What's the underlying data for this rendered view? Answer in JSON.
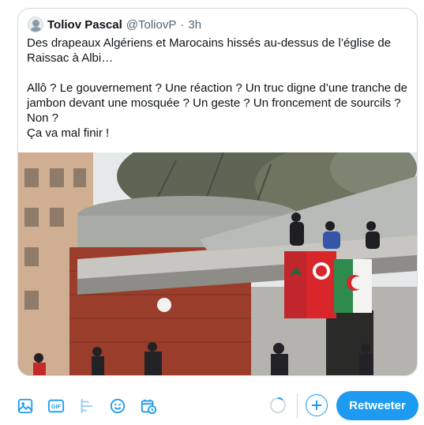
{
  "tweet": {
    "author_name": "Toliov Pascal",
    "author_handle": "@ToliovP",
    "separator": "·",
    "time": "3h",
    "lines": [
      "Des drapeaux Algériens et Marocains hissés au-dessus de l’église de",
      "Raissac à Albi…",
      "",
      "Allô ? Le gouvernement ? Une réaction ? Un truc digne d’une tranche de",
      "jambon devant une mosquée ? Un geste ? Un froncement de sourcils ?",
      "Non ?",
      "Ça va mal finir !"
    ]
  },
  "media": {
    "description_icon": "photo-of-flags-on-church-roof"
  },
  "toolbar": {
    "icons": [
      "image-icon",
      "gif-icon",
      "poll-icon",
      "emoji-icon",
      "schedule-icon"
    ],
    "retweet_label": "Retweeter"
  },
  "colors": {
    "accent": "#1d9bf0",
    "text": "#0f1419",
    "muted": "#536471",
    "border": "#cfd9de"
  }
}
